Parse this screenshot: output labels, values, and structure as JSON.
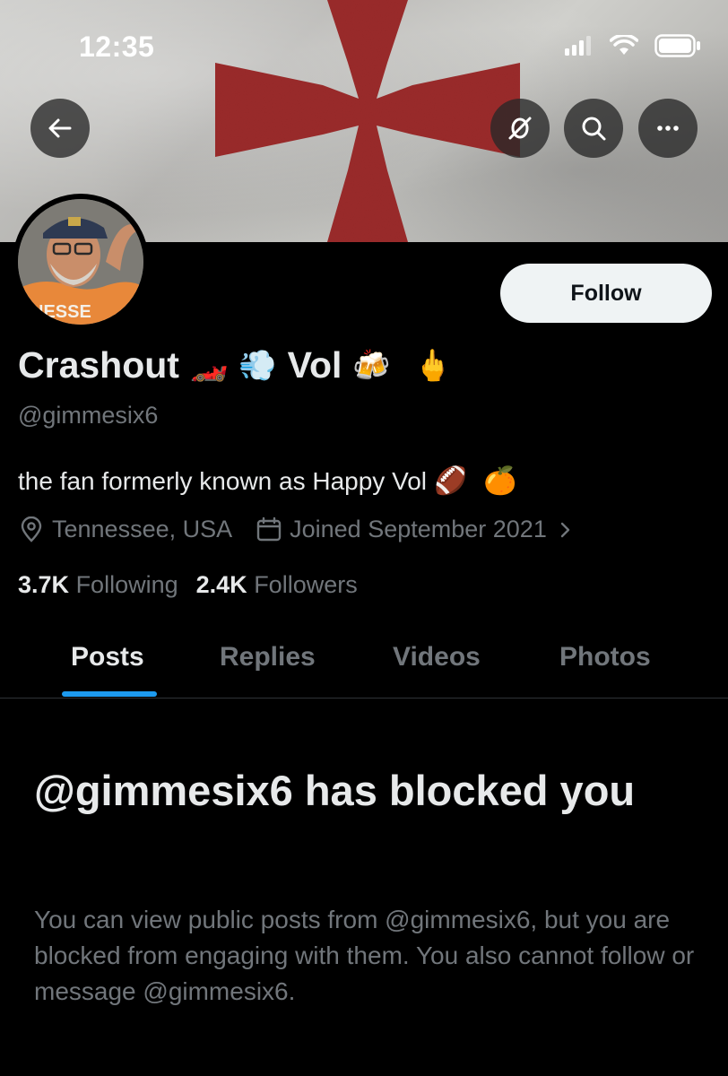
{
  "status_bar": {
    "time": "12:35",
    "icons": [
      "signal-icon",
      "wifi-icon",
      "battery-icon"
    ]
  },
  "header": {
    "back_icon": "arrow-left-icon",
    "actions": [
      "no-notifications-icon",
      "search-icon",
      "more-icon"
    ]
  },
  "profile": {
    "display_name": "Crashout",
    "display_name_part2": "Vol",
    "name_emojis": [
      "🏎️",
      "💨",
      "🍻",
      "🖕"
    ],
    "handle": "@gimmesix6",
    "follow_label": "Follow",
    "bio": "the fan formerly known as Happy Vol",
    "bio_emojis": [
      "🏈",
      "🍊"
    ],
    "location": "Tennessee, USA",
    "joined": "Joined September 2021",
    "following_count": "3.7K",
    "following_label": "Following",
    "followers_count": "2.4K",
    "followers_label": "Followers"
  },
  "tabs": [
    {
      "label": "Posts",
      "active": true
    },
    {
      "label": "Replies",
      "active": false
    },
    {
      "label": "Videos",
      "active": false
    },
    {
      "label": "Photos",
      "active": false
    }
  ],
  "blocked": {
    "title": "@gimmesix6 has blocked you",
    "description": "You can view public posts from @gimmesix6, but you are blocked from engaging with them. You also cannot follow or message @gimmesix6."
  },
  "colors": {
    "background": "#000000",
    "primary_text": "#e7e9ea",
    "secondary_text": "#71767b",
    "accent": "#1d9bf0",
    "follow_bg": "#eff3f4",
    "cross_red": "#9b2b2b"
  }
}
